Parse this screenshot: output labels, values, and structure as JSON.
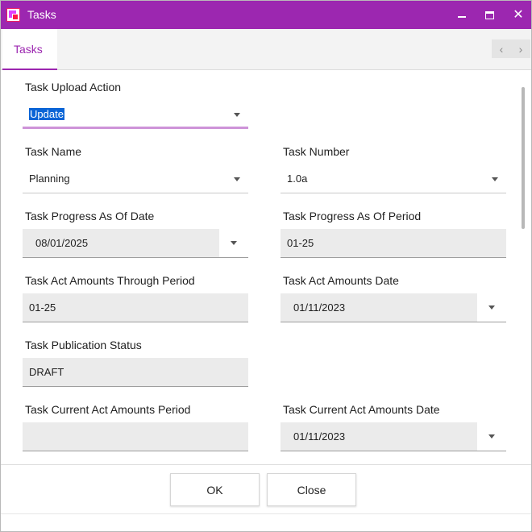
{
  "window": {
    "title": "Tasks"
  },
  "tabs": [
    {
      "label": "Tasks"
    }
  ],
  "nav": {
    "prev_icon": "chevron-left-icon",
    "next_icon": "chevron-right-icon",
    "prev_glyph": "‹",
    "next_glyph": "›"
  },
  "colors": {
    "accent": "#9c27b0",
    "active_underline": "#ce93d8",
    "selection": "#0a64d6",
    "field_bg": "#ebebeb"
  },
  "form": {
    "upload_action": {
      "label": "Task Upload Action",
      "value": "Update"
    },
    "task_name": {
      "label": "Task Name",
      "value": "Planning"
    },
    "task_number": {
      "label": "Task Number",
      "value": "1.0a"
    },
    "progress_date": {
      "label": "Task Progress As Of Date",
      "value": "08/01/2025"
    },
    "progress_period": {
      "label": "Task Progress As Of Period",
      "value": "01-25"
    },
    "act_through_period": {
      "label": "Task Act Amounts Through Period",
      "value": "01-25"
    },
    "act_date": {
      "label": "Task Act Amounts Date",
      "value": "01/11/2023"
    },
    "publication_status": {
      "label": "Task Publication Status",
      "value": "DRAFT"
    },
    "current_act_period": {
      "label": "Task Current Act Amounts Period",
      "value": ""
    },
    "current_act_date": {
      "label": "Task Current Act Amounts Date",
      "value": "01/11/2023"
    }
  },
  "footer": {
    "ok_label": "OK",
    "close_label": "Close"
  }
}
